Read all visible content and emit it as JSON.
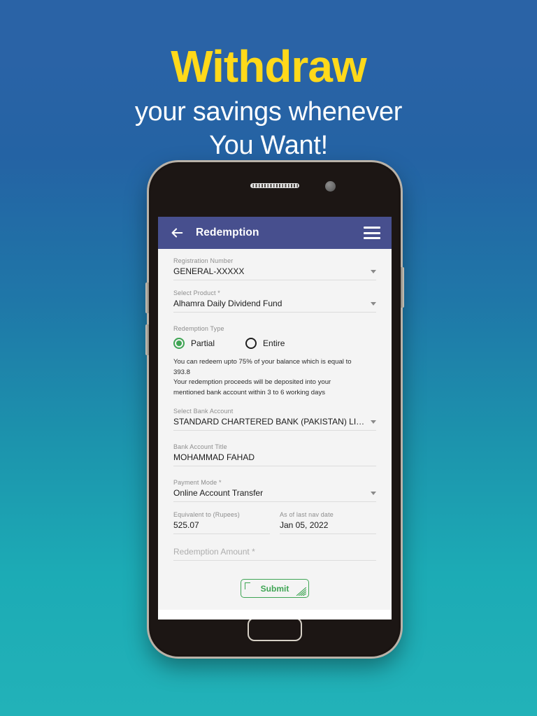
{
  "promo": {
    "title": "Withdraw",
    "subtitle_line1": "your savings whenever",
    "subtitle_line2": "You Want!",
    "title_color": "#ffd91a",
    "subtitle_color": "#ffffff",
    "background_top_color": "#2a63a6",
    "background_bottom_color": "#22b2b8"
  },
  "app": {
    "appbar": {
      "title": "Redemption",
      "back_icon": "back-arrow-icon",
      "menu_icon": "hamburger-menu-icon",
      "background_color": "#474f8e",
      "text_color": "#ffffff"
    },
    "form": {
      "registration_number": {
        "label": "Registration Number",
        "value": "GENERAL-XXXXX",
        "dropdown_icon": "chevron-down-icon"
      },
      "select_product": {
        "label": "Select Product *",
        "value": "Alhamra Daily Dividend Fund",
        "dropdown_icon": "chevron-down-icon"
      },
      "redemption_type": {
        "label": "Redemption Type",
        "options": [
          {
            "label": "Partial",
            "selected": true
          },
          {
            "label": "Entire",
            "selected": false
          }
        ],
        "selected_color": "#3fa554"
      },
      "info_lines": [
        "You can redeem upto 75% of your balance which is equal to",
        "393.8",
        "Your redemption proceeds will be deposited into your",
        "mentioned bank account within 3 to 6 working days"
      ],
      "select_bank_account": {
        "label": "Select Bank Account",
        "value": "STANDARD CHARTERED BANK (PAKISTAN) LIM…",
        "dropdown_icon": "chevron-down-icon"
      },
      "bank_account_title": {
        "label": "Bank Account Title",
        "value": "MOHAMMAD FAHAD"
      },
      "payment_mode": {
        "label": "Payment Mode *",
        "value": "Online Account Transfer",
        "dropdown_icon": "chevron-down-icon"
      },
      "equivalent_to": {
        "label": "Equivalent to (Rupees)",
        "value": "525.07"
      },
      "nav_date": {
        "label": "As of last nav date",
        "value": "Jan 05, 2022"
      },
      "redemption_amount": {
        "label": "",
        "placeholder": "Redemption Amount *",
        "value": ""
      },
      "submit": {
        "label": "Submit",
        "color": "#3fa554"
      }
    }
  },
  "device": {
    "speaker_icon": "speaker-grille-icon",
    "camera_icon": "front-camera-icon",
    "home_button_icon": "home-button-icon",
    "volume_up_icon": "volume-up-button-icon",
    "volume_down_icon": "volume-down-button-icon",
    "power_icon": "power-button-icon"
  }
}
